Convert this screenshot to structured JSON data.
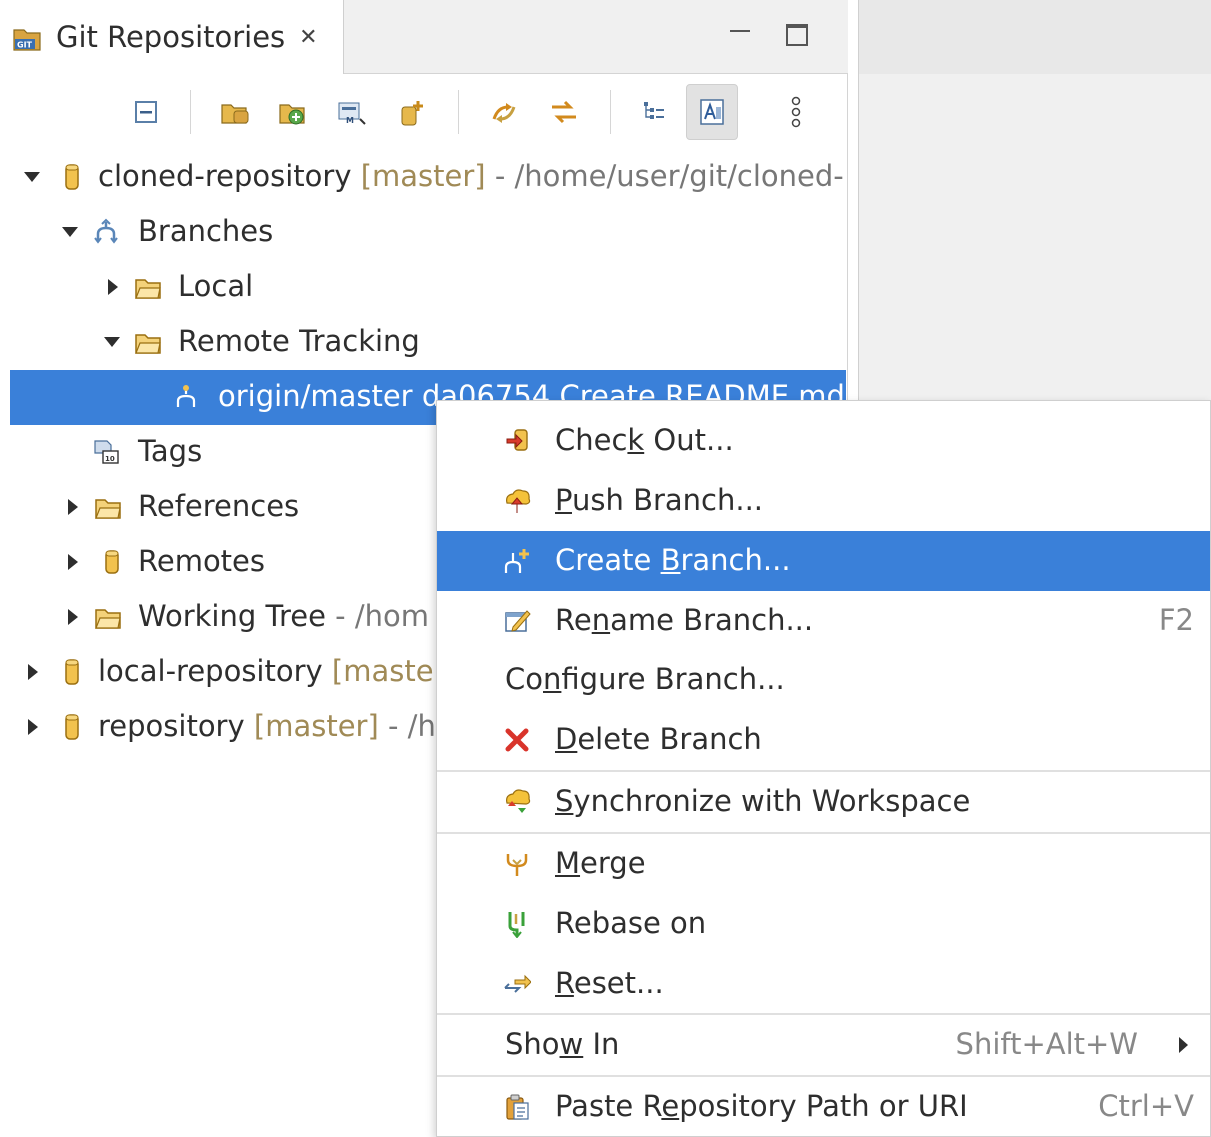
{
  "view": {
    "title": "Git Repositories",
    "close_glyph": "✕"
  },
  "toolbar": {
    "buttons": [
      {
        "name": "collapse-all-icon"
      },
      {
        "name": "add-existing-repository-icon"
      },
      {
        "name": "clone-repository-icon"
      },
      {
        "name": "create-repository-icon"
      },
      {
        "name": "add-repository-icon"
      },
      {
        "name": "link-with-selection-icon"
      },
      {
        "name": "refresh-icon"
      },
      {
        "name": "hierarchical-branch-layout-icon"
      },
      {
        "name": "show-editor-icon",
        "active": true
      },
      {
        "name": "view-menu-icon"
      }
    ]
  },
  "tree": {
    "cloned_repo": {
      "name": "cloned-repository",
      "branch": "[master]",
      "path": "- /home/user/git/cloned-"
    },
    "branches": "Branches",
    "local": "Local",
    "remote_tracking": "Remote Tracking",
    "selected_branch": "origin/master da06754 Create README.md",
    "tags": "Tags",
    "references": "References",
    "remotes": "Remotes",
    "working_tree": {
      "name": "Working Tree",
      "path": "- /hom"
    },
    "local_repo": {
      "name": "local-repository",
      "branch": "[maste"
    },
    "repo": {
      "name": "repository",
      "branch": "[master]",
      "path": "- /h"
    }
  },
  "menu": {
    "check_out": {
      "pre": "Chec",
      "mn": "k",
      "post": " Out..."
    },
    "push_branch": {
      "pre": "",
      "mn": "P",
      "post": "ush Branch..."
    },
    "create_branch": {
      "pre": "Create ",
      "mn": "B",
      "post": "ranch..."
    },
    "rename_branch": {
      "pre": "Re",
      "mn": "n",
      "post": "ame Branch...",
      "accel": "F2"
    },
    "configure_branch": {
      "pre": "Co",
      "mn": "n",
      "post": "figure Branch..."
    },
    "delete_branch": {
      "pre": "",
      "mn": "D",
      "post": "elete Branch"
    },
    "synchronize": {
      "pre": "",
      "mn": "S",
      "post": "ynchronize with Workspace"
    },
    "merge": {
      "pre": "",
      "mn": "M",
      "post": "erge"
    },
    "rebase": {
      "label": "Rebase on"
    },
    "reset": {
      "pre": "",
      "mn": "R",
      "post": "eset..."
    },
    "show_in": {
      "pre": "Sho",
      "mn": "w",
      "post": " In",
      "accel": "Shift+Alt+W"
    },
    "paste_path": {
      "pre": "Paste R",
      "mn": "e",
      "post": "pository Path or URI",
      "accel": "Ctrl+V"
    }
  },
  "colors": {
    "selection": "#3a80d9",
    "branch_decoration": "#a08a56",
    "path_decoration": "#777777"
  }
}
